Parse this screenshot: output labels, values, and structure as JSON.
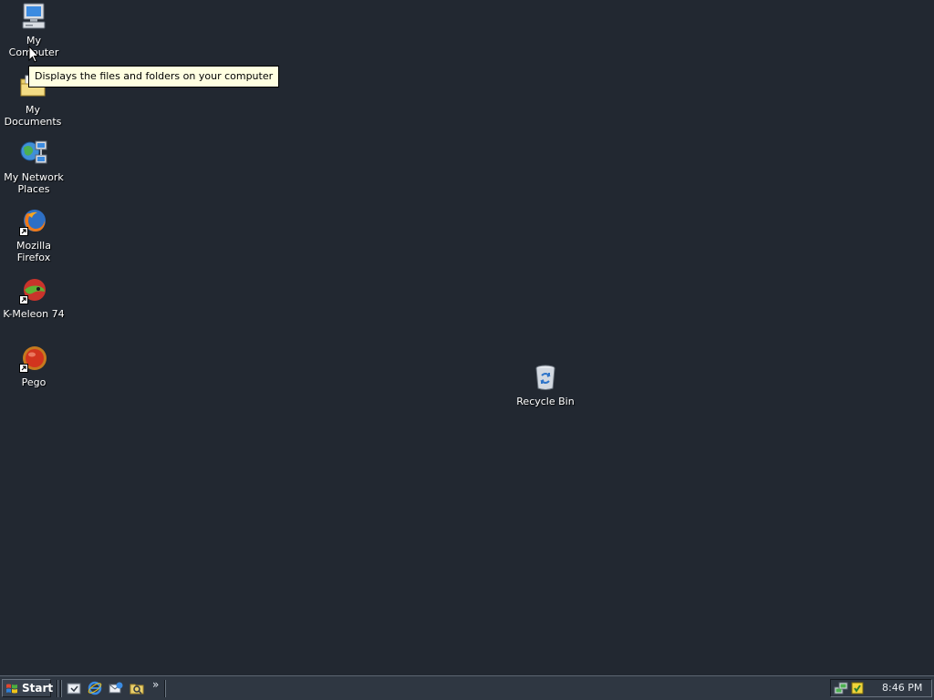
{
  "desktop": {
    "icons": [
      {
        "name": "my-computer",
        "label": "My Computer",
        "icon": "computer-icon"
      },
      {
        "name": "my-documents",
        "label": "My Documents",
        "icon": "folder-icon"
      },
      {
        "name": "my-network-places",
        "label": "My Network\nPlaces",
        "icon": "network-icon"
      },
      {
        "name": "mozilla-firefox",
        "label": "Mozilla Firefox",
        "icon": "firefox-icon",
        "shortcut": true
      },
      {
        "name": "k-meleon",
        "label": "K-Meleon 74",
        "icon": "kmeleon-icon",
        "shortcut": true
      },
      {
        "name": "pego",
        "label": "Pego",
        "icon": "pego-icon",
        "shortcut": true
      },
      {
        "name": "recycle-bin",
        "label": "Recycle Bin",
        "icon": "recycle-bin-icon"
      }
    ],
    "tooltip": "Displays the files and folders on your computer",
    "background_color": "#222831"
  },
  "taskbar": {
    "start_label": "Start",
    "quick_launch": [
      {
        "name": "show-desktop",
        "icon": "show-desktop-icon"
      },
      {
        "name": "internet-explorer",
        "icon": "ie-icon"
      },
      {
        "name": "outlook-express",
        "icon": "mail-icon"
      },
      {
        "name": "windows-explorer",
        "icon": "explorer-icon"
      }
    ],
    "chevron": "»",
    "tray_icons": [
      {
        "name": "network-tray",
        "icon": "network-tray-icon"
      },
      {
        "name": "security-tray",
        "icon": "security-tray-icon"
      }
    ],
    "clock": "8:46 PM"
  }
}
